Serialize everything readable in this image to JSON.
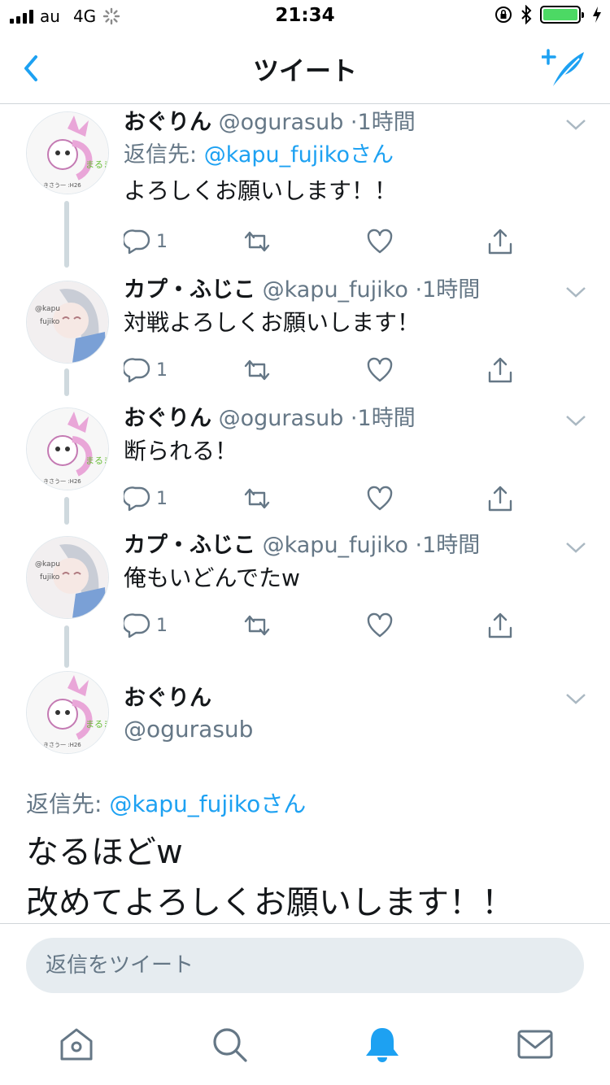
{
  "status_bar": {
    "carrier": "au",
    "network": "4G",
    "time": "21:34",
    "battery_level": 1.0
  },
  "nav": {
    "title": "ツイート",
    "back_icon": "chevron-left-icon",
    "compose_icon": "compose-tweet-icon"
  },
  "colors": {
    "accent": "#1da1f2",
    "text_primary": "#14171a",
    "text_secondary": "#657786",
    "battery": "#4cd964"
  },
  "tweets": [
    {
      "name": "おぐりん",
      "handle": "@ogurasub",
      "dot": "·",
      "time": "1時間",
      "reply_prefix": "返信先: ",
      "reply_to": "@kapu_fujikoさん",
      "text": "よろしくお願いします！！",
      "reply_count": "1"
    },
    {
      "name": "カプ・ふじこ",
      "handle": "@kapu_fujiko",
      "dot": "·",
      "time": "1時間",
      "text": "対戦よろしくお願いします！",
      "reply_count": "1"
    },
    {
      "name": "おぐりん",
      "handle": "@ogurasub",
      "dot": "·",
      "time": "1時間",
      "text": "断られる！",
      "reply_count": "1"
    },
    {
      "name": "カプ・ふじこ",
      "handle": "@kapu_fujiko",
      "dot": "·",
      "time": "1時間",
      "text": "俺もいどんでたw",
      "reply_count": "1"
    }
  ],
  "main_tweet": {
    "name": "おぐりん",
    "handle": "@ogurasub",
    "reply_prefix": "返信先: ",
    "reply_to": "@kapu_fujikoさん",
    "text_line1": "なるほどw",
    "text_line2": "改めてよろしくお願いします！！"
  },
  "reply_bar": {
    "placeholder": "返信をツイート"
  },
  "tab_bar": {
    "items": [
      "home-icon",
      "search-icon",
      "notifications-icon",
      "messages-icon"
    ],
    "active": "notifications-icon"
  }
}
